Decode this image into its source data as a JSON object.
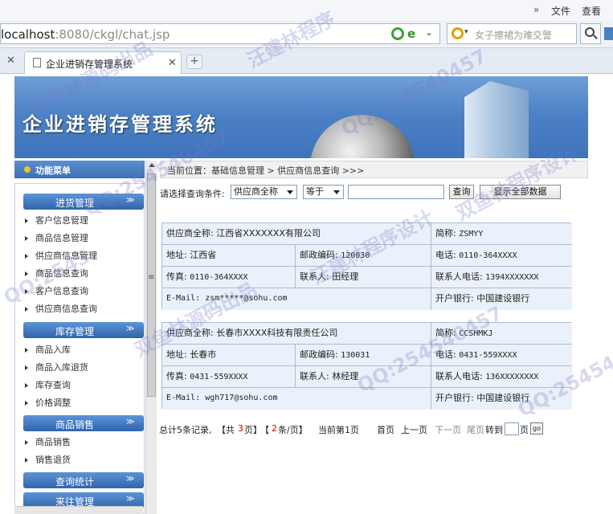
{
  "browser": {
    "menu_chevron": "»",
    "menu_file": "文件",
    "menu_view": "查看",
    "url_host": "localhost",
    "url_rest": ":8080/ckgl/chat.jsp",
    "search_placeholder": "女子擦裙为难交警",
    "tab_title": "企业进销存管理系统",
    "close_glyph": "✕",
    "new_tab_glyph": "+"
  },
  "banner": {
    "title": "企业进销存管理系统"
  },
  "sidebar": {
    "header": "功能菜单",
    "sections": [
      {
        "title": "进货管理",
        "items": [
          "客户信息管理",
          "商品信息管理",
          "供应商信息管理",
          "商品信息查询",
          "客户信息查询",
          "供应商信息查询"
        ]
      },
      {
        "title": "库存管理",
        "items": [
          "商品入库",
          "商品入库退货",
          "库存查询",
          "价格调整"
        ]
      },
      {
        "title": "商品销售",
        "items": [
          "商品销售",
          "销售退货"
        ]
      },
      {
        "title": "查询统计",
        "items": []
      },
      {
        "title": "来往管理",
        "items": []
      }
    ],
    "toggle_glyph": "≫"
  },
  "breadcrumb": "当前位置：基础信息管理 > 供应商信息查询 >>>",
  "query": {
    "label": "请选择查询条件:",
    "field_select": "供应商全称",
    "op_select": "等于",
    "input_value": "",
    "query_button": "查询",
    "show_all_button": "显示全部数据"
  },
  "suppliers": [
    {
      "name_label": "供应商全称:",
      "name": "江西省XXXXXXX有限公司",
      "short_label": "简称:",
      "short": "ZSMYY",
      "addr_label": "地址:",
      "addr": "江西省",
      "zip_label": "邮政编码:",
      "zip": "120030",
      "phone_label": "电话:",
      "phone": "0110-364XXXX",
      "fax_label": "传真:",
      "fax": "0110-364XXXX",
      "contact_label": "联系人:",
      "contact": "田经理",
      "cphone_label": "联系人电话:",
      "cphone": "1394XXXXXXX",
      "email_label": "E-Mail:",
      "email": "zsm*****@sohu.com",
      "bank_label": "开户银行:",
      "bank": "中国建设银行"
    },
    {
      "name_label": "供应商全称:",
      "name": "长春市XXXX科技有限责任公司",
      "short_label": "简称:",
      "short": "CCSHMKJ",
      "addr_label": "地址:",
      "addr": "长春市",
      "zip_label": "邮政编码:",
      "zip": "130031",
      "phone_label": "电话:",
      "phone": "0431-559XXXX",
      "fax_label": "传真:",
      "fax": "0431-559XXXX",
      "contact_label": "联系人:",
      "contact": "林经理",
      "cphone_label": "联系人电话:",
      "cphone": "136XXXXXXXX",
      "email_label": "E-Mail:",
      "email": "wgh717@sohu.com",
      "bank_label": "开户银行:",
      "bank": "中国建设银行"
    }
  ],
  "pager": {
    "total_prefix": "总计5条记录,",
    "pages_open": "【共",
    "pages_count": "3",
    "pages_close": "页】",
    "per_open": "【",
    "per_count": "2",
    "per_close": "条/页】",
    "current": "当前第1页",
    "first": "首页",
    "prev": "上一页",
    "next": "下一页",
    "last": "尾页",
    "goto": "转到",
    "page_unit": "页",
    "go_button": "go"
  },
  "watermarks": [
    "双鱼林源码出品",
    "汪建林程序",
    "QQ:254540457",
    "双鱼林程序设计",
    "QQ:254540457",
    "汪建林程序设计",
    "双鱼林源码出品",
    "QQ:254540457",
    "QQ:25454",
    "QQ:2545"
  ]
}
